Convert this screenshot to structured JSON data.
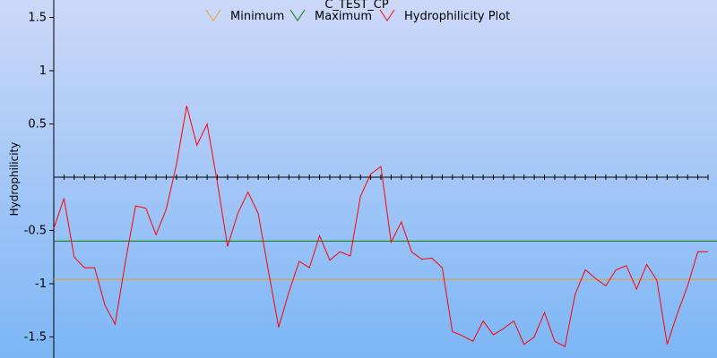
{
  "chart_data": {
    "type": "line",
    "title": "C_TEST_CP",
    "ylabel": "Hydrophilicity",
    "xlabel": "",
    "ylim": [
      -1.6,
      1.6
    ],
    "yticks": [
      1.5,
      1,
      0.5,
      -0.5,
      -1,
      -1.5
    ],
    "ytick_labels": [
      "1.5",
      "1",
      "0.5",
      "-0.5",
      "-1",
      "-1.5"
    ],
    "grid": false,
    "legend_position": "top-center",
    "background": {
      "top": "#ccd8f8",
      "bottom": "#7cb6f6"
    },
    "reference_lines": [
      {
        "name": "Minimum",
        "y": -0.96,
        "color": "#f0a020"
      },
      {
        "name": "Maximum",
        "y": -0.6,
        "color": "#008000"
      }
    ],
    "series": [
      {
        "name": "Hydrophilicity Plot",
        "color": "#ff0000",
        "values": [
          -0.48,
          -0.2,
          -0.75,
          -0.85,
          -0.85,
          -1.2,
          -1.38,
          -0.8,
          -0.27,
          -0.29,
          -0.54,
          -0.3,
          0.12,
          0.67,
          0.3,
          0.5,
          -0.05,
          -0.65,
          -0.34,
          -0.14,
          -0.34,
          -0.88,
          -1.41,
          -1.08,
          -0.79,
          -0.85,
          -0.55,
          -0.78,
          -0.7,
          -0.74,
          -0.18,
          0.03,
          0.1,
          -0.61,
          -0.42,
          -0.7,
          -0.77,
          -0.76,
          -0.85,
          -1.45,
          -1.49,
          -1.54,
          -1.35,
          -1.48,
          -1.42,
          -1.35,
          -1.57,
          -1.5,
          -1.27,
          -1.54,
          -1.59,
          -1.1,
          -0.87,
          -0.95,
          -1.02,
          -0.87,
          -0.83,
          -1.05,
          -0.82,
          -0.97,
          -1.57,
          -1.28,
          -1.02,
          -0.7,
          -0.7
        ]
      }
    ]
  }
}
